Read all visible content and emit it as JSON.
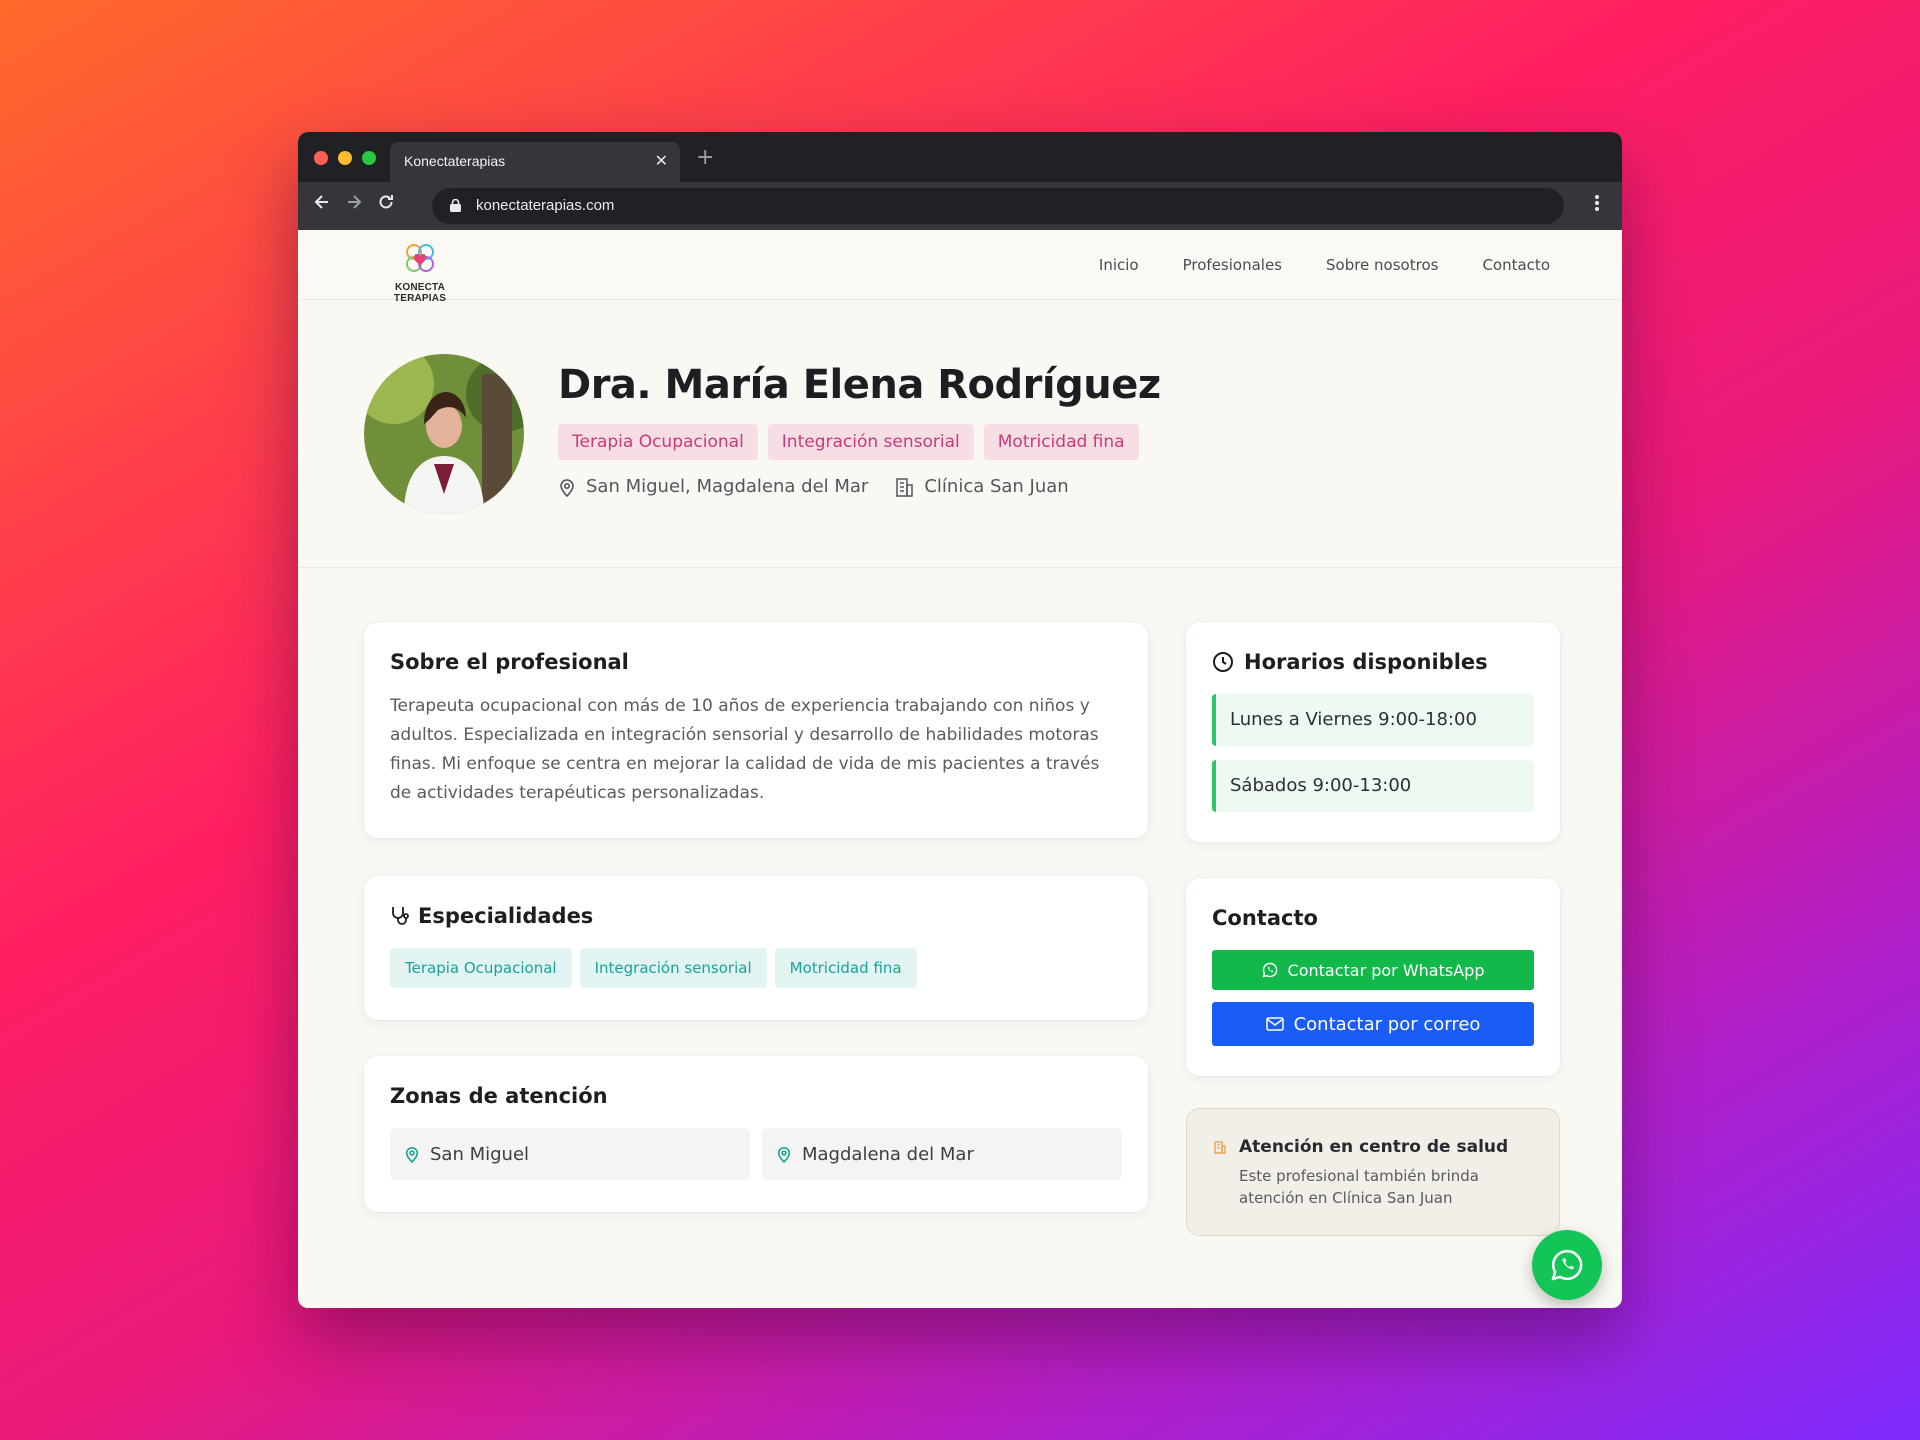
{
  "browser": {
    "tab_title": "Konectaterapias",
    "tab_close": "✕",
    "new_tab": "+",
    "url": "konectaterapias.com"
  },
  "site": {
    "logo_text": "KONECTA TERAPIAS",
    "nav": [
      "Inicio",
      "Profesionales",
      "Sobre nosotros",
      "Contacto"
    ]
  },
  "profile": {
    "name": "Dra. María Elena Rodríguez",
    "tags": [
      "Terapia Ocupacional",
      "Integración sensorial",
      "Motricidad fina"
    ],
    "location": "San Miguel, Magdalena del Mar",
    "clinic": "Clínica San Juan"
  },
  "about": {
    "title": "Sobre el profesional",
    "text": "Terapeuta ocupacional con más de 10 años de experiencia trabajando con niños y adultos. Especializada en integración sensorial y desarrollo de habilidades motoras finas. Mi enfoque se centra en mejorar la calidad de vida de mis pacientes a través de actividades terapéuticas personalizadas."
  },
  "specialties": {
    "title": "Especialidades",
    "items": [
      "Terapia Ocupacional",
      "Integración sensorial",
      "Motricidad fina"
    ]
  },
  "zones": {
    "title": "Zonas de atención",
    "items": [
      "San Miguel",
      "Magdalena del Mar"
    ]
  },
  "hours": {
    "title": "Horarios disponibles",
    "slots": [
      "Lunes a Viernes 9:00-18:00",
      "Sábados 9:00-13:00"
    ]
  },
  "contact": {
    "title": "Contacto",
    "whatsapp_label": "Contactar por WhatsApp",
    "email_label": "Contactar por correo"
  },
  "health_center": {
    "title": "Atención en centro de salud",
    "text": "Este profesional también brinda atención en Clínica San Juan"
  },
  "colors": {
    "accent_pink": "#cc3a78",
    "accent_teal": "#1aa39a",
    "whatsapp_green": "#12b94a",
    "email_blue": "#1a5cf6"
  }
}
